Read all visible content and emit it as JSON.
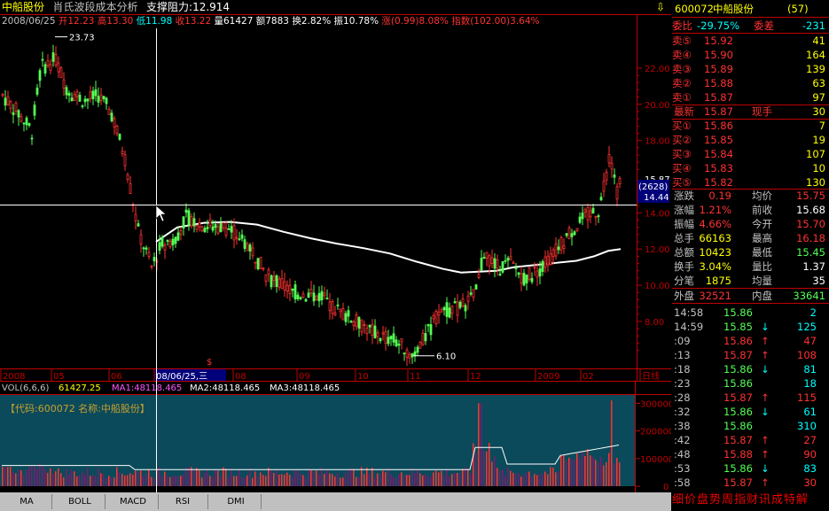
{
  "title": {
    "stock_name": "中船股份",
    "indicator": "肖氏波段成本分析",
    "support_label": "支撑阻力:12.914"
  },
  "info": {
    "date": "2008/06/25",
    "open": "开12.23",
    "high": "高13.30",
    "low": "低11.98",
    "close": "收13.22",
    "volume": "量61427",
    "amount": "额7883",
    "turnover": "换2.82%",
    "amplitude": "振10.78%",
    "change": "涨(0.99)8.08%",
    "index": "指数(102.00)3.64%"
  },
  "chart_data": {
    "type": "candlestick",
    "y_ticks": [
      "22.00",
      "20.00",
      "18.00",
      "16.00",
      "14.00",
      "12.00",
      "10.00",
      "8.00"
    ],
    "ylim": [
      5.5,
      24.2
    ],
    "high_mark": "23.73",
    "low_mark": "6.10",
    "current_price_label": "15.87",
    "crosshair_price": "14.44",
    "crosshair_volume": "(2628)",
    "x_labels": [
      "2008",
      "05",
      "06",
      "08/06/25,三",
      "08",
      "09",
      "10",
      "11",
      "12",
      "2009",
      "02",
      "日线"
    ],
    "vol_legend": [
      "VOL(6,6,6)",
      "61427.25",
      "MA1:48118.465",
      "MA2:48118.465",
      "MA3:48118.465"
    ],
    "vol_ticks": [
      "300000",
      "200000",
      "100000",
      "0"
    ],
    "vol_ylim": [
      0,
      330000
    ],
    "code_label": "【代码:600072 名称:中船股份】",
    "cost_line": [
      [
        176,
        12.4
      ],
      [
        200,
        13.2
      ],
      [
        230,
        13.45
      ],
      [
        260,
        13.5
      ],
      [
        290,
        13.35
      ],
      [
        320,
        12.95
      ],
      [
        350,
        12.6
      ],
      [
        380,
        12.3
      ],
      [
        410,
        12.05
      ],
      [
        440,
        11.75
      ],
      [
        470,
        11.3
      ],
      [
        500,
        10.9
      ],
      [
        520,
        10.7
      ],
      [
        540,
        10.75
      ],
      [
        560,
        10.8
      ],
      [
        580,
        11.0
      ],
      [
        600,
        11.1
      ],
      [
        620,
        11.2
      ],
      [
        650,
        11.35
      ],
      [
        670,
        11.6
      ],
      [
        686,
        11.9
      ],
      [
        700,
        12.0
      ]
    ]
  },
  "quote": {
    "code": "600072",
    "name": "中船股份",
    "count": "(57)",
    "ratio_label": "委比",
    "ratio": "-29.75%",
    "diff_label": "委差",
    "diff": "-231",
    "sells": [
      {
        "label": "卖⑤",
        "price": "15.92",
        "vol": "41"
      },
      {
        "label": "卖④",
        "price": "15.90",
        "vol": "164"
      },
      {
        "label": "卖③",
        "price": "15.89",
        "vol": "139"
      },
      {
        "label": "卖②",
        "price": "15.88",
        "vol": "63"
      },
      {
        "label": "卖①",
        "price": "15.87",
        "vol": "97"
      }
    ],
    "last": {
      "label": "最新",
      "price": "15.87",
      "hand_label": "现手",
      "hand": "30"
    },
    "buys": [
      {
        "label": "买①",
        "price": "15.86",
        "vol": "7"
      },
      {
        "label": "买②",
        "price": "15.85",
        "vol": "19"
      },
      {
        "label": "买③",
        "price": "15.84",
        "vol": "107"
      },
      {
        "label": "买④",
        "price": "15.83",
        "vol": "10"
      },
      {
        "label": "买⑤",
        "price": "15.82",
        "vol": "130"
      }
    ],
    "stats": [
      {
        "l1": "涨跌",
        "v1": "0.19",
        "l2": "均价",
        "v2": "15.75"
      },
      {
        "l1": "涨幅",
        "v1": "1.21%",
        "l2": "前收",
        "v2": "15.68"
      },
      {
        "l1": "振幅",
        "v1": "4.66%",
        "l2": "今开",
        "v2": "15.70"
      },
      {
        "l1": "总手",
        "v1": "66163",
        "l2": "最高",
        "v2": "16.18"
      },
      {
        "l1": "总额",
        "v1": "10423",
        "l2": "最低",
        "v2": "15.45"
      },
      {
        "l1": "换手",
        "v1": "3.04%",
        "l2": "量比",
        "v2": "1.37"
      },
      {
        "l1": "分笔",
        "v1": "1875",
        "l2": "均量",
        "v2": "35"
      }
    ],
    "outer_label": "外盘",
    "outer": "32521",
    "inner_label": "内盘",
    "inner": "33641",
    "ticks": [
      {
        "time": "14:58",
        "price": "15.86",
        "arrow": "",
        "vol": "2"
      },
      {
        "time": "14:59",
        "price": "15.85",
        "arrow": "↓",
        "vol": "125"
      },
      {
        "time": ":09",
        "price": "15.86",
        "arrow": "↑",
        "vol": "47"
      },
      {
        "time": ":13",
        "price": "15.87",
        "arrow": "↑",
        "vol": "108"
      },
      {
        "time": ":18",
        "price": "15.86",
        "arrow": "↓",
        "vol": "81"
      },
      {
        "time": ":23",
        "price": "15.86",
        "arrow": "",
        "vol": "18"
      },
      {
        "time": ":28",
        "price": "15.87",
        "arrow": "↑",
        "vol": "115"
      },
      {
        "time": ":32",
        "price": "15.86",
        "arrow": "↓",
        "vol": "61"
      },
      {
        "time": ":38",
        "price": "15.86",
        "arrow": "",
        "vol": "310"
      },
      {
        "time": ":42",
        "price": "15.87",
        "arrow": "↑",
        "vol": "27"
      },
      {
        "time": ":48",
        "price": "15.88",
        "arrow": "↑",
        "vol": "90"
      },
      {
        "time": ":53",
        "price": "15.86",
        "arrow": "↓",
        "vol": "83"
      },
      {
        "time": ":58",
        "price": "15.87",
        "arrow": "↑",
        "vol": "30"
      }
    ]
  },
  "tabs": [
    "MA",
    "BOLL",
    "MACD",
    "RSI",
    "DMI"
  ],
  "bottom_nav": "细价盘势周指财讯成特解",
  "colors": {
    "up": "#ff3232",
    "down": "#54ff54",
    "axis": "#c00000",
    "text": "#c0c0c0",
    "yellow": "#ffff00",
    "cyan": "#00ffff",
    "white": "#ffffff",
    "vol_bg": "#0b4a5a"
  }
}
